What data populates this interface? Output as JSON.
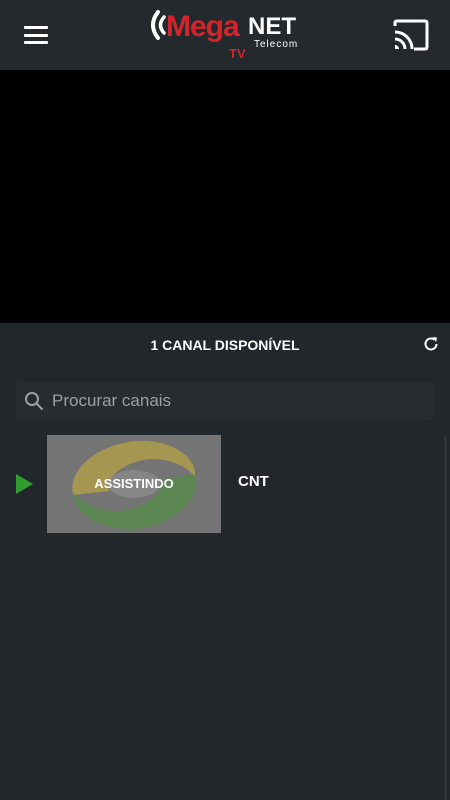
{
  "header": {
    "logo": {
      "brand_primary": "Mega",
      "brand_secondary": "NET",
      "brand_tagline": "Telecom",
      "brand_suffix": "TV"
    },
    "menu_icon": "hamburger-menu-icon",
    "cast_icon": "cast-icon"
  },
  "channels": {
    "count_label": "1 CANAL DISPONÍVEL",
    "refresh_icon": "refresh-icon",
    "search": {
      "placeholder": "Procurar canais",
      "value": "",
      "icon": "search-icon"
    },
    "items": [
      {
        "name": "CNT",
        "status_label": "ASSISTINDO",
        "playing": true
      }
    ]
  },
  "colors": {
    "background": "#22272b",
    "brand_red": "#d3242b",
    "play_green": "#2e9e2e",
    "player_background": "#000000"
  }
}
